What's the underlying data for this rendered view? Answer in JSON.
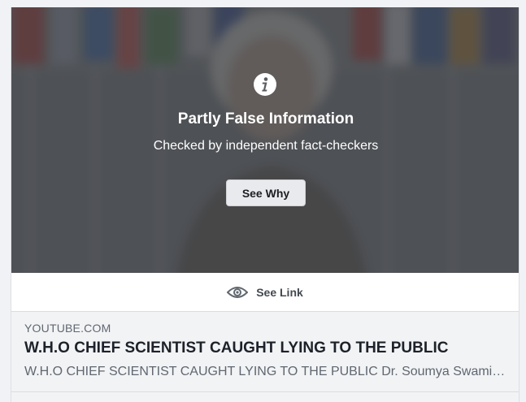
{
  "warning": {
    "icon": "info-icon",
    "title": "Partly False Information",
    "subtitle": "Checked by independent fact-checkers",
    "button_label": "See Why"
  },
  "see_link": {
    "icon": "eye-icon",
    "label": "See Link"
  },
  "link_preview": {
    "domain": "YOUTUBE.COM",
    "title": "W.H.O CHIEF SCIENTIST CAUGHT LYING TO THE PUBLIC",
    "description": "W.H.O CHIEF SCIENTIST CAUGHT LYING TO THE PUBLIC Dr. Soumya Swaminathan"
  },
  "colors": {
    "overlay": "#5d5f63",
    "button_bg": "#e9eaed",
    "preview_bg": "#f2f3f5",
    "page_bg": "#f0f2f5"
  }
}
